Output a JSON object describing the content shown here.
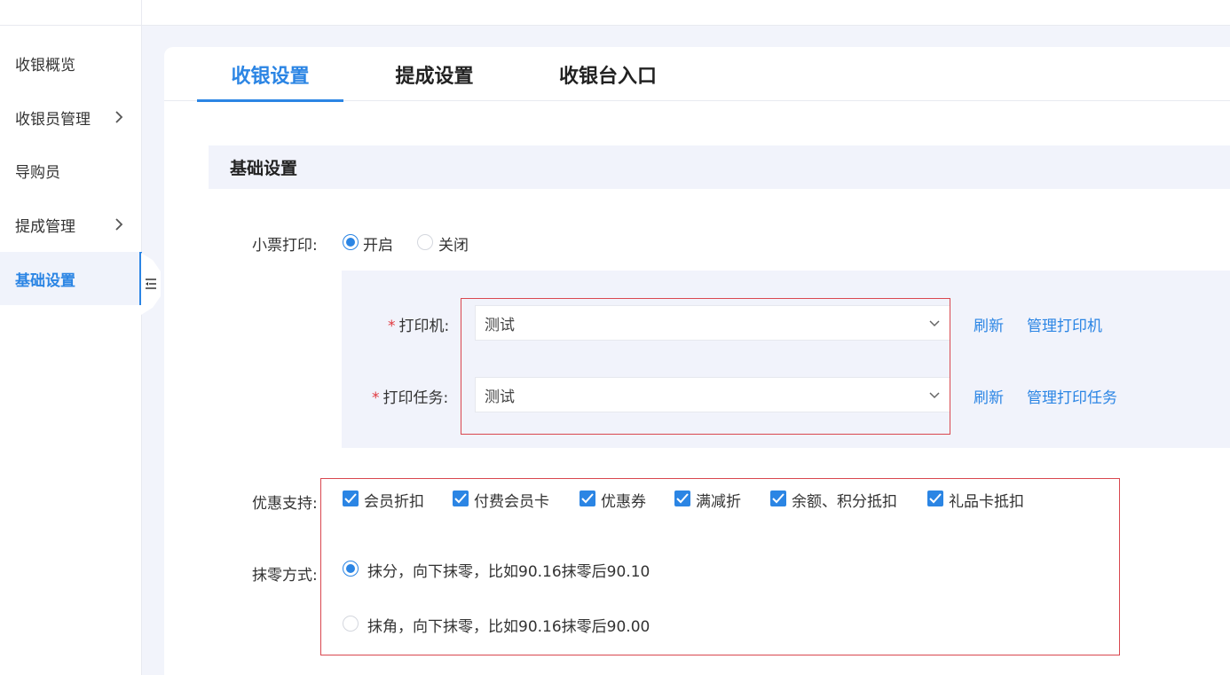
{
  "sidebar": {
    "items": [
      {
        "label": "收银概览",
        "has_children": false,
        "active": false
      },
      {
        "label": "收银员管理",
        "has_children": true,
        "active": false
      },
      {
        "label": "导购员",
        "has_children": false,
        "active": false
      },
      {
        "label": "提成管理",
        "has_children": true,
        "active": false
      },
      {
        "label": "基础设置",
        "has_children": false,
        "active": true
      }
    ]
  },
  "tabs": [
    {
      "label": "收银设置",
      "active": true
    },
    {
      "label": "提成设置",
      "active": false
    },
    {
      "label": "收银台入口",
      "active": false
    }
  ],
  "section": {
    "title": "基础设置"
  },
  "ticket_print": {
    "label": "小票打印:",
    "options": [
      {
        "label": "开启",
        "selected": true
      },
      {
        "label": "关闭",
        "selected": false
      }
    ]
  },
  "printer": {
    "required_mark": "*",
    "label": "打印机:",
    "value": "测试",
    "refresh": "刷新",
    "manage": "管理打印机"
  },
  "print_task": {
    "required_mark": "*",
    "label": "打印任务:",
    "value": "测试",
    "refresh": "刷新",
    "manage": "管理打印任务"
  },
  "discount": {
    "label": "优惠支持:",
    "options": [
      {
        "label": "会员折扣",
        "checked": true
      },
      {
        "label": "付费会员卡",
        "checked": true
      },
      {
        "label": "优惠券",
        "checked": true
      },
      {
        "label": "满减折",
        "checked": true
      },
      {
        "label": "余额、积分抵扣",
        "checked": true
      },
      {
        "label": "礼品卡抵扣",
        "checked": true
      }
    ]
  },
  "rounding": {
    "label": "抹零方式:",
    "options": [
      {
        "label": "抹分，向下抹零，比如90.16抹零后90.10",
        "selected": true
      },
      {
        "label": "抹角，向下抹零，比如90.16抹零后90.00",
        "selected": false
      }
    ]
  },
  "colors": {
    "accent": "#2b85e4",
    "highlight_border": "#d9474f",
    "required": "#e0383e"
  }
}
